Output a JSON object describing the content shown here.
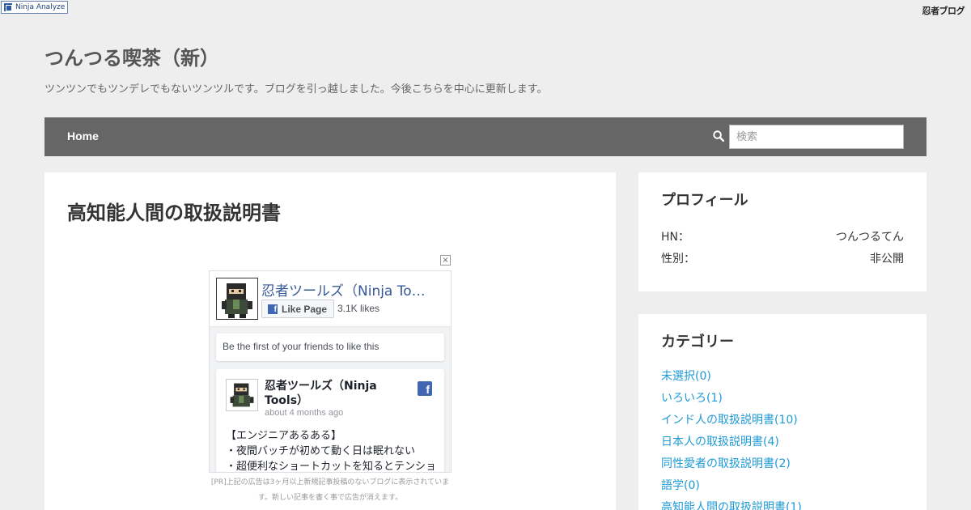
{
  "topbar": {
    "badge_label": "Ninja Analyze",
    "logo_text": "忍者ブログ"
  },
  "site": {
    "title": "つんつる喫茶（新）",
    "description": "ツンツンでもツンデレでもないツンツルです。ブログを引っ越しました。今後こちらを中心に更新します。"
  },
  "nav": {
    "home_label": "Home",
    "search_placeholder": "検索"
  },
  "post": {
    "title": "高知能人間の取扱説明書"
  },
  "ad": {
    "close_label": "×",
    "page_name": "忍者ツールズ（Ninja Tools）",
    "like_button": "Like Page",
    "likes_count": "3.1K likes",
    "friends_text": "Be the first of your friends to like this",
    "post_author": "忍者ツールズ（Ninja Tools）",
    "post_time": "about 4 months ago",
    "fb_icon_glyph": "f",
    "post_lines": [
      "【エンジニアあるある】",
      "・夜間バッチが初めて動く日は眠れない",
      "・超便利なショートカットを知るとテンション上がる"
    ],
    "pr_note": "[PR]上記の広告は3ヶ月以上新規記事投稿のないブログに表示されています。新しい記事を書く事で広告が消えます。"
  },
  "sidebar": {
    "profile": {
      "title": "プロフィール",
      "rows": [
        {
          "label": "HN：",
          "value": "つんつるてん"
        },
        {
          "label": "性別：",
          "value": "非公開"
        }
      ]
    },
    "categories": {
      "title": "カテゴリー",
      "items": [
        "未選択(0)",
        "いろいろ(1)",
        "インド人の取扱説明書(10)",
        "日本人の取扱説明書(4)",
        "同性愛者の取扱説明書(2)",
        "語学(0)",
        "高知能人間の取扱説明書(1)"
      ]
    }
  },
  "colors": {
    "nav_bg": "#666666",
    "link": "#1e9ad6",
    "fb_blue": "#4267b2",
    "fb_name": "#365899"
  }
}
